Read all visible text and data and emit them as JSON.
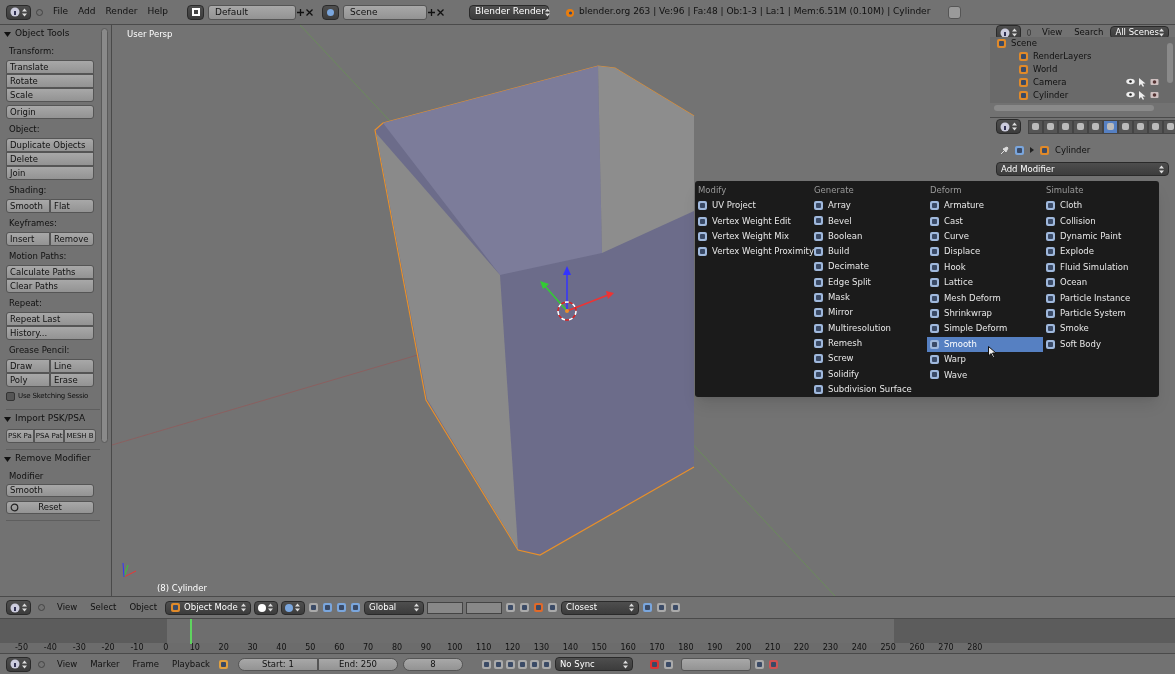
{
  "top_bar": {
    "menus": [
      "File",
      "Add",
      "Render",
      "Help"
    ],
    "layout": "Default",
    "scene": "Scene",
    "engine": "Blender Render",
    "stats": "blender.org 263 | Ve:96 | Fa:48 | Ob:1-3 | La:1 | Mem:6.51M (0.10M) | Cylinder"
  },
  "tool_shelf": [
    {
      "title": "Object Tools",
      "expanded": true,
      "items": [
        {
          "kind": "label",
          "text": "Transform:"
        },
        {
          "kind": "buttons",
          "rows": [
            [
              "Translate"
            ],
            [
              "Rotate"
            ],
            [
              "Scale"
            ]
          ]
        },
        {
          "kind": "buttons",
          "rows": [
            [
              "Origin"
            ]
          ]
        },
        {
          "kind": "label",
          "text": "Object:"
        },
        {
          "kind": "buttons",
          "rows": [
            [
              "Duplicate Objects"
            ],
            [
              "Delete"
            ],
            [
              "Join"
            ]
          ]
        },
        {
          "kind": "label",
          "text": "Shading:"
        },
        {
          "kind": "buttons",
          "rows": [
            [
              "Smooth",
              "Flat"
            ]
          ]
        },
        {
          "kind": "label",
          "text": "Keyframes:"
        },
        {
          "kind": "buttons",
          "rows": [
            [
              "Insert",
              "Remove"
            ]
          ]
        },
        {
          "kind": "label",
          "text": "Motion Paths:"
        },
        {
          "kind": "buttons",
          "rows": [
            [
              "Calculate Paths"
            ],
            [
              "Clear Paths"
            ]
          ]
        },
        {
          "kind": "label",
          "text": "Repeat:"
        },
        {
          "kind": "buttons",
          "rows": [
            [
              "Repeat Last"
            ],
            [
              "History..."
            ]
          ]
        },
        {
          "kind": "label",
          "text": "Grease Pencil:"
        },
        {
          "kind": "buttons",
          "rows": [
            [
              "Draw",
              "Line"
            ],
            [
              "Poly",
              "Erase"
            ]
          ]
        },
        {
          "kind": "checkbox",
          "text": "Use Sketching Sessio",
          "checked": false
        }
      ]
    },
    {
      "title": "Import PSK/PSA",
      "expanded": true,
      "items": [
        {
          "kind": "buttons",
          "rows": [
            [
              "PSK Pa",
              "PSA Pat",
              "MESH B"
            ]
          ]
        }
      ]
    },
    {
      "title": "Remove Modifier",
      "expanded": true,
      "items": [
        {
          "kind": "label",
          "text": "Modifier"
        },
        {
          "kind": "field",
          "text": "Smooth"
        },
        {
          "kind": "icon_button",
          "text": "Reset"
        }
      ]
    }
  ],
  "viewport": {
    "view_name": "User Persp",
    "object_label": "(8) Cylinder"
  },
  "modifier_menu": [
    {
      "title": "Modify",
      "items": [
        {
          "label": "UV Project",
          "selected": false
        },
        {
          "label": "Vertex Weight Edit",
          "selected": false
        },
        {
          "label": "Vertex Weight Mix",
          "selected": false
        },
        {
          "label": "Vertex Weight Proximity",
          "selected": false
        }
      ]
    },
    {
      "title": "Generate",
      "items": [
        {
          "label": "Array",
          "selected": false
        },
        {
          "label": "Bevel",
          "selected": false
        },
        {
          "label": "Boolean",
          "selected": false
        },
        {
          "label": "Build",
          "selected": false
        },
        {
          "label": "Decimate",
          "selected": false
        },
        {
          "label": "Edge Split",
          "selected": false
        },
        {
          "label": "Mask",
          "selected": false
        },
        {
          "label": "Mirror",
          "selected": false
        },
        {
          "label": "Multiresolution",
          "selected": false
        },
        {
          "label": "Remesh",
          "selected": false
        },
        {
          "label": "Screw",
          "selected": false
        },
        {
          "label": "Solidify",
          "selected": false
        },
        {
          "label": "Subdivision Surface",
          "selected": false
        }
      ]
    },
    {
      "title": "Deform",
      "items": [
        {
          "label": "Armature",
          "selected": false
        },
        {
          "label": "Cast",
          "selected": false
        },
        {
          "label": "Curve",
          "selected": false
        },
        {
          "label": "Displace",
          "selected": false
        },
        {
          "label": "Hook",
          "selected": false
        },
        {
          "label": "Lattice",
          "selected": false
        },
        {
          "label": "Mesh Deform",
          "selected": false
        },
        {
          "label": "Shrinkwrap",
          "selected": false
        },
        {
          "label": "Simple Deform",
          "selected": false
        },
        {
          "label": "Smooth",
          "selected": true
        },
        {
          "label": "Warp",
          "selected": false
        },
        {
          "label": "Wave",
          "selected": false
        }
      ]
    },
    {
      "title": "Simulate",
      "items": [
        {
          "label": "Cloth",
          "selected": false
        },
        {
          "label": "Collision",
          "selected": false
        },
        {
          "label": "Dynamic Paint",
          "selected": false
        },
        {
          "label": "Explode",
          "selected": false
        },
        {
          "label": "Fluid Simulation",
          "selected": false
        },
        {
          "label": "Ocean",
          "selected": false
        },
        {
          "label": "Particle Instance",
          "selected": false
        },
        {
          "label": "Particle System",
          "selected": false
        },
        {
          "label": "Smoke",
          "selected": false
        },
        {
          "label": "Soft Body",
          "selected": false
        }
      ]
    }
  ],
  "outliner": {
    "menus": [
      "View",
      "Search"
    ],
    "filter": "All Scenes",
    "tree": [
      {
        "label": "Scene",
        "toggles": false,
        "children": [
          {
            "label": "RenderLayers",
            "toggles": false
          },
          {
            "label": "World",
            "toggles": false
          },
          {
            "label": "Camera",
            "toggles": true
          },
          {
            "label": "Cylinder",
            "toggles": true
          }
        ]
      }
    ]
  },
  "properties": {
    "tabs": [
      {
        "selected": false
      },
      {
        "selected": false
      },
      {
        "selected": false
      },
      {
        "selected": false
      },
      {
        "selected": false
      },
      {
        "selected": true
      },
      {
        "selected": false
      },
      {
        "selected": false
      },
      {
        "selected": false
      },
      {
        "selected": false
      }
    ],
    "object": "Cylinder",
    "add_modifier": "Add Modifier"
  },
  "view3d_header": {
    "menus": [
      "View",
      "Select",
      "Object"
    ],
    "mode": "Object Mode",
    "orientation": "Global",
    "snap": "Closest"
  },
  "timeline": {
    "ticks": [
      "-50",
      "-40",
      "-30",
      "-20",
      "-10",
      "0",
      "10",
      "20",
      "30",
      "40",
      "50",
      "60",
      "70",
      "80",
      "90",
      "100",
      "110",
      "120",
      "130",
      "140",
      "150",
      "160",
      "170",
      "180",
      "190",
      "200",
      "210",
      "220",
      "230",
      "240",
      "250",
      "260",
      "270",
      "280"
    ]
  },
  "timeline_header": {
    "menus": [
      "View",
      "Marker",
      "Frame",
      "Playback"
    ],
    "start": "Start: 1",
    "end": "End: 250",
    "frame": "8",
    "sync": "No Sync"
  }
}
